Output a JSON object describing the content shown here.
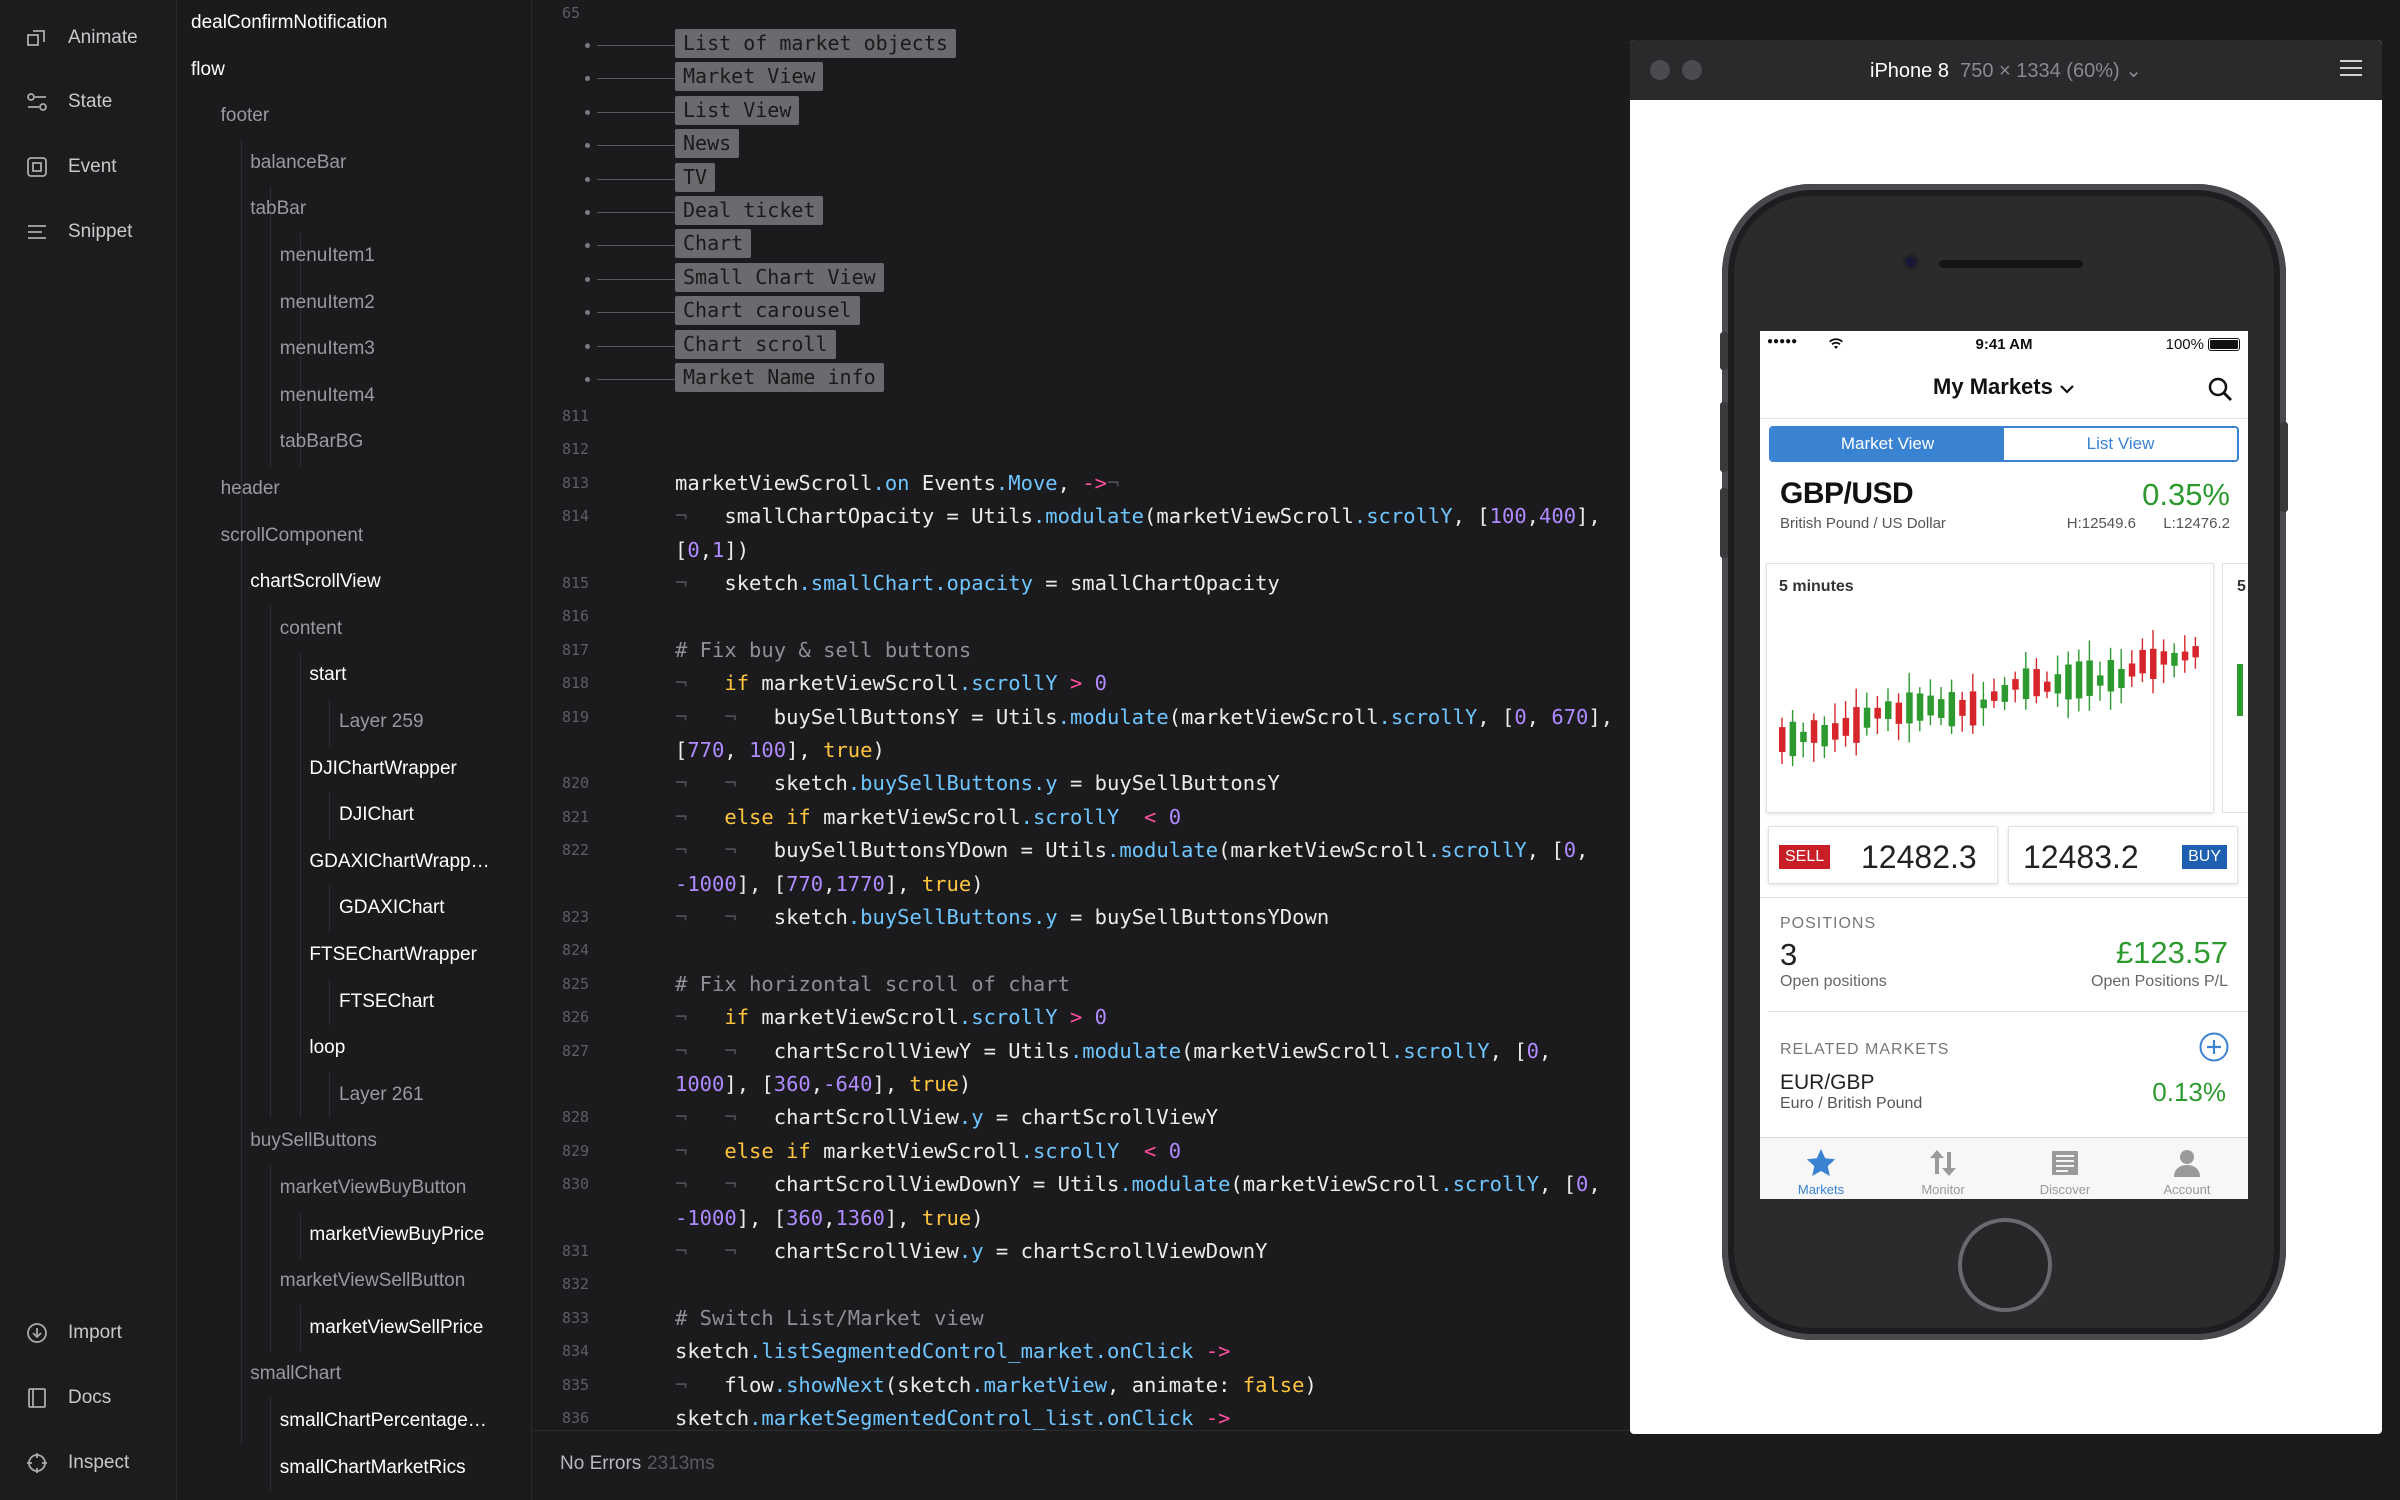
{
  "rail": {
    "items": [
      {
        "label": "Animate",
        "icon": "animate-icon"
      },
      {
        "label": "State",
        "icon": "state-icon"
      },
      {
        "label": "Event",
        "icon": "event-icon"
      },
      {
        "label": "Snippet",
        "icon": "snippet-icon"
      }
    ],
    "bottom": [
      {
        "label": "Import",
        "icon": "import-icon"
      },
      {
        "label": "Docs",
        "icon": "docs-icon"
      },
      {
        "label": "Inspect",
        "icon": "inspect-icon"
      }
    ]
  },
  "layers": [
    {
      "label": "dealConfirmNotification",
      "depth": 0,
      "bright": true
    },
    {
      "label": "flow",
      "depth": 0,
      "bright": true
    },
    {
      "label": "footer",
      "depth": 1
    },
    {
      "label": "balanceBar",
      "depth": 2
    },
    {
      "label": "tabBar",
      "depth": 2
    },
    {
      "label": "menuItem1",
      "depth": 3
    },
    {
      "label": "menuItem2",
      "depth": 3
    },
    {
      "label": "menuItem3",
      "depth": 3
    },
    {
      "label": "menuItem4",
      "depth": 3
    },
    {
      "label": "tabBarBG",
      "depth": 3
    },
    {
      "label": "header",
      "depth": 1
    },
    {
      "label": "scrollComponent",
      "depth": 1
    },
    {
      "label": "chartScrollView",
      "depth": 2,
      "bright": true
    },
    {
      "label": "content",
      "depth": 3
    },
    {
      "label": "start",
      "depth": 4,
      "bright": true
    },
    {
      "label": "Layer 259",
      "depth": 5
    },
    {
      "label": "DJIChartWrapper",
      "depth": 4,
      "bright": true
    },
    {
      "label": "DJIChart",
      "depth": 5,
      "bright": true
    },
    {
      "label": "GDAXIChartWrapp…",
      "depth": 4,
      "bright": true
    },
    {
      "label": "GDAXIChart",
      "depth": 5,
      "bright": true
    },
    {
      "label": "FTSEChartWrapper",
      "depth": 4,
      "bright": true
    },
    {
      "label": "FTSEChart",
      "depth": 5,
      "bright": true
    },
    {
      "label": "loop",
      "depth": 4,
      "bright": true
    },
    {
      "label": "Layer 261",
      "depth": 5
    },
    {
      "label": "buySellButtons",
      "depth": 2
    },
    {
      "label": "marketViewBuyButton",
      "depth": 3
    },
    {
      "label": "marketViewBuyPrice",
      "depth": 4,
      "bright": true
    },
    {
      "label": "marketViewSellButton",
      "depth": 3
    },
    {
      "label": "marketViewSellPrice",
      "depth": 4,
      "bright": true
    },
    {
      "label": "smallChart",
      "depth": 2
    },
    {
      "label": "smallChartPercentage…",
      "depth": 3,
      "bright": true
    },
    {
      "label": "smallChartMarketRics",
      "depth": 3,
      "bright": true
    }
  ],
  "editor": {
    "first_line_number": "65",
    "outline": [
      "List of market objects",
      "Market View",
      "List View",
      "News",
      "TV",
      "Deal ticket",
      "Chart",
      "Small Chart View",
      "Chart carousel",
      "Chart scroll",
      "Market Name info"
    ],
    "lines": [
      {
        "n": "811",
        "tokens": []
      },
      {
        "n": "812",
        "tokens": []
      },
      {
        "n": "813",
        "tokens": [
          [
            "t",
            "marketViewScroll"
          ],
          [
            "p",
            ".on"
          ],
          [
            "t",
            " Events"
          ],
          [
            "p",
            ".Move"
          ],
          [
            "t",
            ", "
          ],
          [
            "a",
            "->"
          ],
          [
            "m",
            "¬"
          ]
        ]
      },
      {
        "n": "814",
        "tokens": [
          [
            "m",
            "¬   "
          ],
          [
            "t",
            "smallChartOpacity = Utils"
          ],
          [
            "p",
            ".modulate"
          ],
          [
            "t",
            "(marketViewScroll"
          ],
          [
            "p",
            ".scrollY"
          ],
          [
            "t",
            ", ["
          ],
          [
            "n",
            "100"
          ],
          [
            "t",
            ","
          ],
          [
            "n",
            "400"
          ],
          [
            "t",
            "],"
          ]
        ]
      },
      {
        "n": "",
        "tokens": [
          [
            "t",
            "["
          ],
          [
            "n",
            "0"
          ],
          [
            "t",
            ","
          ],
          [
            "n",
            "1"
          ],
          [
            "t",
            "])"
          ]
        ]
      },
      {
        "n": "815",
        "tokens": [
          [
            "m",
            "¬   "
          ],
          [
            "t",
            "sketch"
          ],
          [
            "p",
            ".smallChart.opacity"
          ],
          [
            "t",
            " = smallChartOpacity"
          ]
        ]
      },
      {
        "n": "816",
        "tokens": []
      },
      {
        "n": "817",
        "tokens": [
          [
            "c",
            "# Fix buy & sell buttons"
          ]
        ]
      },
      {
        "n": "818",
        "tokens": [
          [
            "m",
            "¬   "
          ],
          [
            "k",
            "if"
          ],
          [
            "t",
            " marketViewScroll"
          ],
          [
            "p",
            ".scrollY"
          ],
          [
            "a",
            " >"
          ],
          [
            "n",
            " 0"
          ]
        ]
      },
      {
        "n": "819",
        "tokens": [
          [
            "m",
            "¬   ¬   "
          ],
          [
            "t",
            "buySellButtonsY = Utils"
          ],
          [
            "p",
            ".modulate"
          ],
          [
            "t",
            "(marketViewScroll"
          ],
          [
            "p",
            ".scrollY"
          ],
          [
            "t",
            ", ["
          ],
          [
            "n",
            "0"
          ],
          [
            "t",
            ", "
          ],
          [
            "n",
            "670"
          ],
          [
            "t",
            "],"
          ]
        ]
      },
      {
        "n": "",
        "tokens": [
          [
            "t",
            "["
          ],
          [
            "n",
            "770"
          ],
          [
            "t",
            ", "
          ],
          [
            "n",
            "100"
          ],
          [
            "t",
            "], "
          ],
          [
            "k",
            "true"
          ],
          [
            "t",
            ")"
          ]
        ]
      },
      {
        "n": "820",
        "tokens": [
          [
            "m",
            "¬   ¬   "
          ],
          [
            "t",
            "sketch"
          ],
          [
            "p",
            ".buySellButtons.y"
          ],
          [
            "t",
            " = buySellButtonsY"
          ]
        ]
      },
      {
        "n": "821",
        "tokens": [
          [
            "m",
            "¬   "
          ],
          [
            "k",
            "else if"
          ],
          [
            "t",
            " marketViewScroll"
          ],
          [
            "p",
            ".scrollY"
          ],
          [
            "a",
            "  <"
          ],
          [
            "n",
            " 0"
          ]
        ]
      },
      {
        "n": "822",
        "tokens": [
          [
            "m",
            "¬   ¬   "
          ],
          [
            "t",
            "buySellButtonsYDown = Utils"
          ],
          [
            "p",
            ".modulate"
          ],
          [
            "t",
            "(marketViewScroll"
          ],
          [
            "p",
            ".scrollY"
          ],
          [
            "t",
            ", ["
          ],
          [
            "n",
            "0"
          ],
          [
            "t",
            ","
          ]
        ]
      },
      {
        "n": "",
        "tokens": [
          [
            "n",
            "-1000"
          ],
          [
            "t",
            "], ["
          ],
          [
            "n",
            "770"
          ],
          [
            "t",
            ","
          ],
          [
            "n",
            "1770"
          ],
          [
            "t",
            "], "
          ],
          [
            "k",
            "true"
          ],
          [
            "t",
            ")"
          ]
        ]
      },
      {
        "n": "823",
        "tokens": [
          [
            "m",
            "¬   ¬   "
          ],
          [
            "t",
            "sketch"
          ],
          [
            "p",
            ".buySellButtons.y"
          ],
          [
            "t",
            " = buySellButtonsYDown"
          ]
        ]
      },
      {
        "n": "824",
        "tokens": []
      },
      {
        "n": "825",
        "tokens": [
          [
            "c",
            "# Fix horizontal scroll of chart"
          ]
        ]
      },
      {
        "n": "826",
        "tokens": [
          [
            "m",
            "¬   "
          ],
          [
            "k",
            "if"
          ],
          [
            "t",
            " marketViewScroll"
          ],
          [
            "p",
            ".scrollY"
          ],
          [
            "a",
            " >"
          ],
          [
            "n",
            " 0"
          ]
        ]
      },
      {
        "n": "827",
        "tokens": [
          [
            "m",
            "¬   ¬   "
          ],
          [
            "t",
            "chartScrollViewY = Utils"
          ],
          [
            "p",
            ".modulate"
          ],
          [
            "t",
            "(marketViewScroll"
          ],
          [
            "p",
            ".scrollY"
          ],
          [
            "t",
            ", ["
          ],
          [
            "n",
            "0"
          ],
          [
            "t",
            ","
          ]
        ]
      },
      {
        "n": "",
        "tokens": [
          [
            "n",
            "1000"
          ],
          [
            "t",
            "], ["
          ],
          [
            "n",
            "360"
          ],
          [
            "t",
            ","
          ],
          [
            "n",
            "-640"
          ],
          [
            "t",
            "], "
          ],
          [
            "k",
            "true"
          ],
          [
            "t",
            ")"
          ]
        ]
      },
      {
        "n": "828",
        "tokens": [
          [
            "m",
            "¬   ¬   "
          ],
          [
            "t",
            "chartScrollView"
          ],
          [
            "p",
            ".y"
          ],
          [
            "t",
            " = chartScrollViewY"
          ]
        ]
      },
      {
        "n": "829",
        "tokens": [
          [
            "m",
            "¬   "
          ],
          [
            "k",
            "else if"
          ],
          [
            "t",
            " marketViewScroll"
          ],
          [
            "p",
            ".scrollY"
          ],
          [
            "a",
            "  <"
          ],
          [
            "n",
            " 0"
          ]
        ]
      },
      {
        "n": "830",
        "tokens": [
          [
            "m",
            "¬   ¬   "
          ],
          [
            "t",
            "chartScrollViewDownY = Utils"
          ],
          [
            "p",
            ".modulate"
          ],
          [
            "t",
            "(marketViewScroll"
          ],
          [
            "p",
            ".scrollY"
          ],
          [
            "t",
            ", ["
          ],
          [
            "n",
            "0"
          ],
          [
            "t",
            ","
          ]
        ]
      },
      {
        "n": "",
        "tokens": [
          [
            "n",
            "-1000"
          ],
          [
            "t",
            "], ["
          ],
          [
            "n",
            "360"
          ],
          [
            "t",
            ","
          ],
          [
            "n",
            "1360"
          ],
          [
            "t",
            "], "
          ],
          [
            "k",
            "true"
          ],
          [
            "t",
            ")"
          ]
        ]
      },
      {
        "n": "831",
        "tokens": [
          [
            "m",
            "¬   ¬   "
          ],
          [
            "t",
            "chartScrollView"
          ],
          [
            "p",
            ".y"
          ],
          [
            "t",
            " = chartScrollViewDownY"
          ]
        ]
      },
      {
        "n": "832",
        "tokens": []
      },
      {
        "n": "833",
        "tokens": [
          [
            "c",
            "# Switch List/Market view"
          ]
        ]
      },
      {
        "n": "834",
        "tokens": [
          [
            "t",
            "sketch"
          ],
          [
            "p",
            ".listSegmentedControl_market.onClick"
          ],
          [
            "a",
            " ->"
          ]
        ]
      },
      {
        "n": "835",
        "tokens": [
          [
            "m",
            "¬   "
          ],
          [
            "t",
            "flow"
          ],
          [
            "p",
            ".showNext"
          ],
          [
            "t",
            "(sketch"
          ],
          [
            "p",
            ".marketView"
          ],
          [
            "t",
            ", animate: "
          ],
          [
            "k",
            "false"
          ],
          [
            "t",
            ")"
          ]
        ]
      },
      {
        "n": "836",
        "tokens": [
          [
            "t",
            "sketch"
          ],
          [
            "p",
            ".marketSegmentedControl_list.onClick"
          ],
          [
            "a",
            " ->"
          ]
        ]
      }
    ]
  },
  "status": {
    "errors": "No Errors",
    "time": "2313ms"
  },
  "preview": {
    "device": "iPhone 8",
    "resolution": "750 × 1334 (60%)",
    "app": {
      "status_bar": {
        "signal": "●●●●●",
        "time": "9:41 AM",
        "battery": "100%"
      },
      "nav_title": "My Markets",
      "segments": [
        "Market View",
        "List View"
      ],
      "market": {
        "pair": "GBP/USD",
        "name": "British Pound / US Dollar",
        "change": "0.35%",
        "high": "H:12549.6",
        "low": "L:12476.2"
      },
      "chart_label": "5 minutes",
      "chart_peek_label": "5",
      "sell": {
        "tag": "SELL",
        "price": "12482.3"
      },
      "buy": {
        "tag": "BUY",
        "price": "12483.2"
      },
      "positions": {
        "heading": "POSITIONS",
        "count": "3",
        "count_label": "Open positions",
        "pl": "£123.57",
        "pl_label": "Open Positions P/L"
      },
      "related": {
        "heading": "RELATED MARKETS",
        "pair": "EUR/GBP",
        "name": "Euro / British Pound",
        "change": "0.13%"
      },
      "tabs": [
        {
          "label": "Markets",
          "icon": "star-icon"
        },
        {
          "label": "Monitor",
          "icon": "monitor-icon"
        },
        {
          "label": "Discover",
          "icon": "discover-icon"
        },
        {
          "label": "Account",
          "icon": "account-icon"
        }
      ],
      "colors": {
        "accent": "#3a83d3",
        "up": "#2d9a2f",
        "down": "#d7262b"
      }
    }
  }
}
